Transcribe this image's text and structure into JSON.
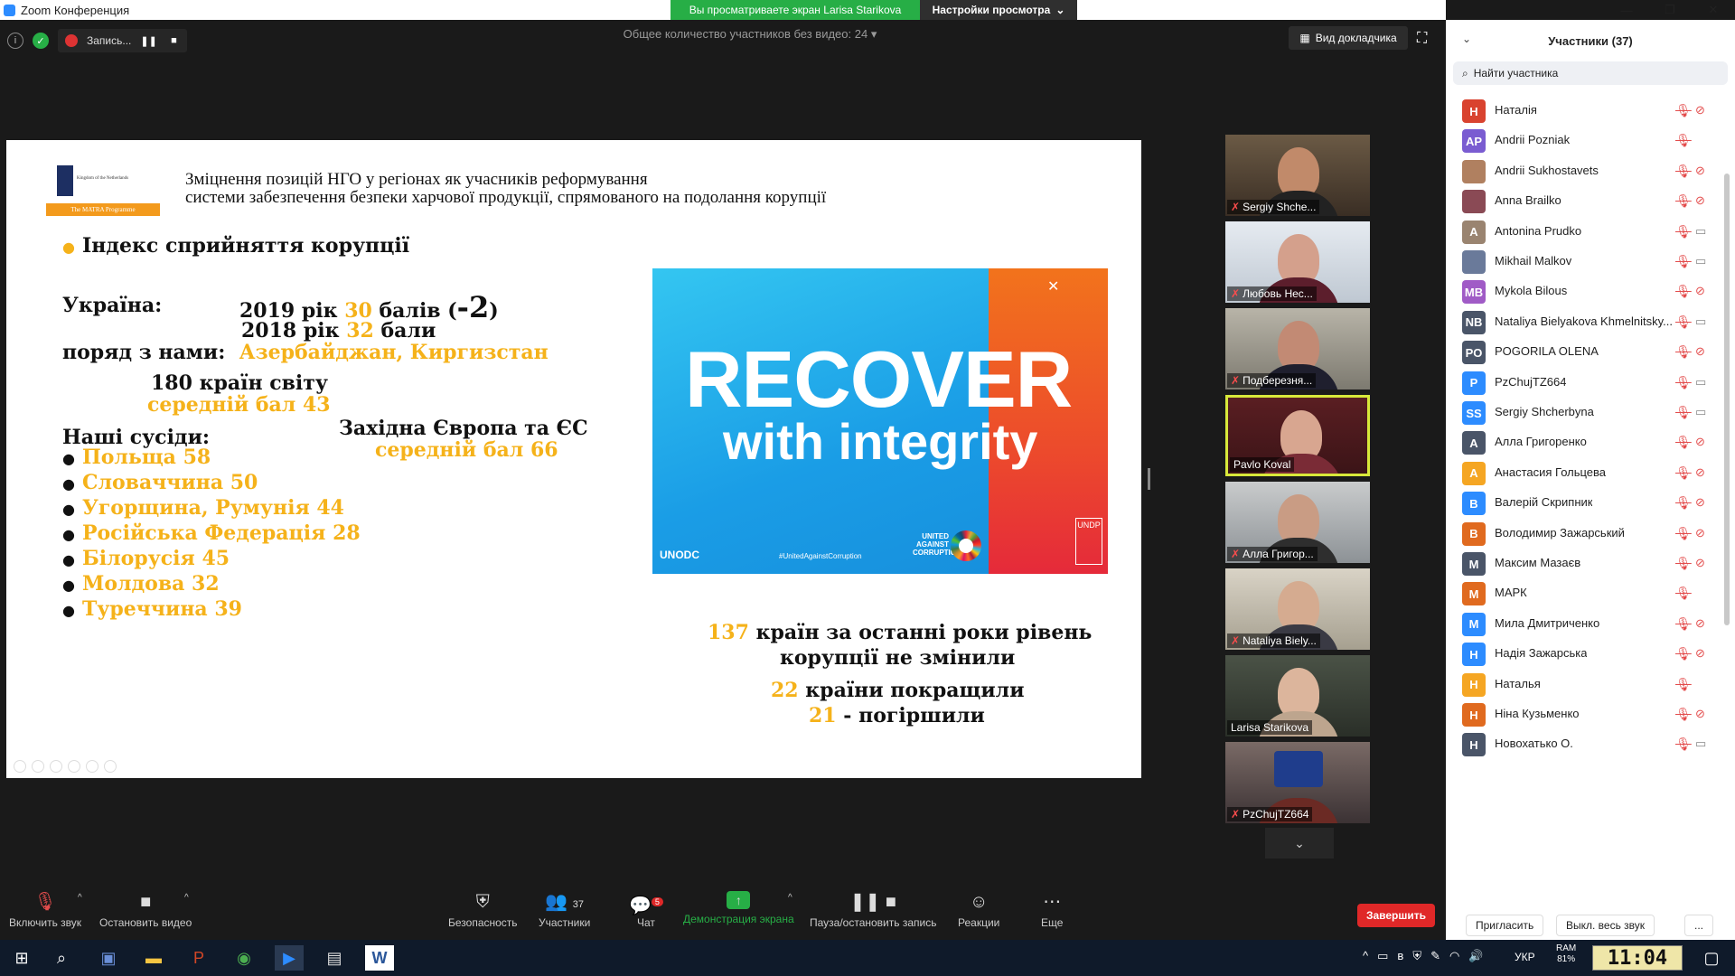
{
  "window": {
    "title": "Zoom Конференция",
    "minimize": "—",
    "maximize": "❐",
    "close": "✕"
  },
  "share_banner": {
    "text": "Вы просматриваете экран Larisa Starikova",
    "view_options": "Настройки просмотра"
  },
  "top_bar": {
    "recording_label": "Запись...",
    "no_video_count": "Общее количество участников без видео: 24",
    "speaker_view": "Вид докладчика"
  },
  "slide": {
    "logo_kingdom": "Kingdom of the Netherlands",
    "logo_programme": "The MATRA Programme",
    "title_line1": "Зміцнення позицій НГО у регіонах як учасників реформування",
    "title_line2": "системи забезпечення безпеки харчової продукції, спрямованого на подолання корупції",
    "index_heading": "Індекс сприйняття корупції",
    "ukraine_label": "Україна:",
    "year2019": "2019 рік",
    "score2019": "30",
    "points2019": "балів (",
    "change2019": "-2",
    "close_paren": ")",
    "year2018": "2018 рік",
    "score2018": "32",
    "points2018": "бали",
    "next_to_us": "поряд з нами:",
    "next_to_us_countries": "Азербайджан, Киргизстан",
    "world": "180 країн світу",
    "world_avg": "середній бал 43",
    "neighbors_heading": "Наші сусіди:",
    "neighbors": [
      "Польща 58",
      "Словаччина 50",
      "Угорщина, Румунія  44",
      "Російська Федерація  28",
      "Білорусія  45",
      "Молдова 32",
      "Туреччина  39"
    ],
    "west_europe": "Західна Європа та ЄС",
    "west_europe_avg": "середній бал 66",
    "recover_word1": "RECOVER",
    "recover_word2": "with integrity",
    "unodc": "UNODC",
    "hashtag": "#UnitedAgainstCorruption",
    "united_against": "UNITED AGAINST CORRUPTION",
    "undp": "UNDP",
    "stat1_num": "137",
    "stat1_text_a": "країн за останні роки рівень",
    "stat1_text_b": "корупції не змінили",
    "stat2_num": "22",
    "stat2_text": "країни покращили",
    "stat3_num": "21",
    "stat3_text": "- погіршили"
  },
  "gallery": [
    {
      "name": "Sergiy Shche...",
      "muted": true
    },
    {
      "name": "Любовь Нес...",
      "muted": true
    },
    {
      "name": "Подберезня...",
      "muted": true
    },
    {
      "name": "Pavlo Koval",
      "muted": false
    },
    {
      "name": "Алла Григор...",
      "muted": true
    },
    {
      "name": "Nataliya Biely...",
      "muted": true
    },
    {
      "name": "Larisa Starikova",
      "muted": false
    },
    {
      "name": "PzChujTZ664",
      "muted": true
    }
  ],
  "toolbar": {
    "mute": "Включить звук",
    "video": "Остановить видео",
    "security": "Безопасность",
    "participants": "Участники",
    "participants_count": "37",
    "chat": "Чат",
    "chat_badge": "5",
    "share": "Демонстрация экрана",
    "record": "Пауза/остановить запись",
    "reactions": "Реакции",
    "more": "Еще",
    "end": "Завершить"
  },
  "panel": {
    "title": "Участники (37)",
    "search_placeholder": "Найти участника",
    "invite": "Пригласить",
    "mute_all": "Выкл. весь звук",
    "more": "...",
    "participants": [
      {
        "initials": "Н",
        "name": "Наталія",
        "color": "#d9432f",
        "video": "off"
      },
      {
        "initials": "AP",
        "name": "Andrii Pozniak",
        "color": "#7a5cd1",
        "video": "none"
      },
      {
        "initials": "",
        "name": "Andrii Sukhostavets",
        "color": "#b08060",
        "video": "off"
      },
      {
        "initials": "",
        "name": "Anna Brailko",
        "color": "#8a4a55",
        "video": "off"
      },
      {
        "initials": "A",
        "name": "Antonina Prudko",
        "color": "#9a8470",
        "video": "on"
      },
      {
        "initials": "",
        "name": "Mikhail Malkov",
        "color": "#6a7a9a",
        "video": "on"
      },
      {
        "initials": "MB",
        "name": "Mykola Bilous",
        "color": "#a05bc6",
        "video": "off"
      },
      {
        "initials": "NB",
        "name": "Nataliya Bielyakova Khmelnitsky...",
        "color": "#4a5568",
        "video": "on"
      },
      {
        "initials": "PO",
        "name": "POGORILA OLENA",
        "color": "#4a5568",
        "video": "off"
      },
      {
        "initials": "P",
        "name": "PzChujTZ664",
        "color": "#2d8cff",
        "video": "on"
      },
      {
        "initials": "SS",
        "name": "Sergiy Shcherbyna",
        "color": "#2d8cff",
        "video": "on"
      },
      {
        "initials": "А",
        "name": "Алла Григоренко",
        "color": "#4a5568",
        "video": "off"
      },
      {
        "initials": "А",
        "name": "Анастасия Гольцева",
        "color": "#f5a623",
        "video": "off"
      },
      {
        "initials": "В",
        "name": "Валерій Скрипник",
        "color": "#2d8cff",
        "video": "off"
      },
      {
        "initials": "В",
        "name": "Володимир Зажарський",
        "color": "#e06a1f",
        "video": "off"
      },
      {
        "initials": "М",
        "name": "Максим Мазаєв",
        "color": "#4a5568",
        "video": "off"
      },
      {
        "initials": "М",
        "name": "МАРК",
        "color": "#e06a1f",
        "video": "none"
      },
      {
        "initials": "М",
        "name": "Мила Дмитриченко",
        "color": "#2d8cff",
        "video": "off"
      },
      {
        "initials": "Н",
        "name": "Надія Зажарська",
        "color": "#2d8cff",
        "video": "off"
      },
      {
        "initials": "Н",
        "name": "Наталья",
        "color": "#f5a623",
        "video": "none"
      },
      {
        "initials": "Н",
        "name": "Ніна Кузьменко",
        "color": "#e06a1f",
        "video": "off"
      },
      {
        "initials": "Н",
        "name": "Новохатько О.",
        "color": "#4a5568",
        "video": "on"
      }
    ]
  },
  "taskbar": {
    "lang": "УКР",
    "ram_label": "RAM",
    "ram_value": "81%",
    "clock": "11:04"
  },
  "colors": {
    "zoom_blue": "#2d8cff",
    "share_green": "#27ae46",
    "slide_yellow": "#f5b21a",
    "end_red": "#e02828"
  }
}
